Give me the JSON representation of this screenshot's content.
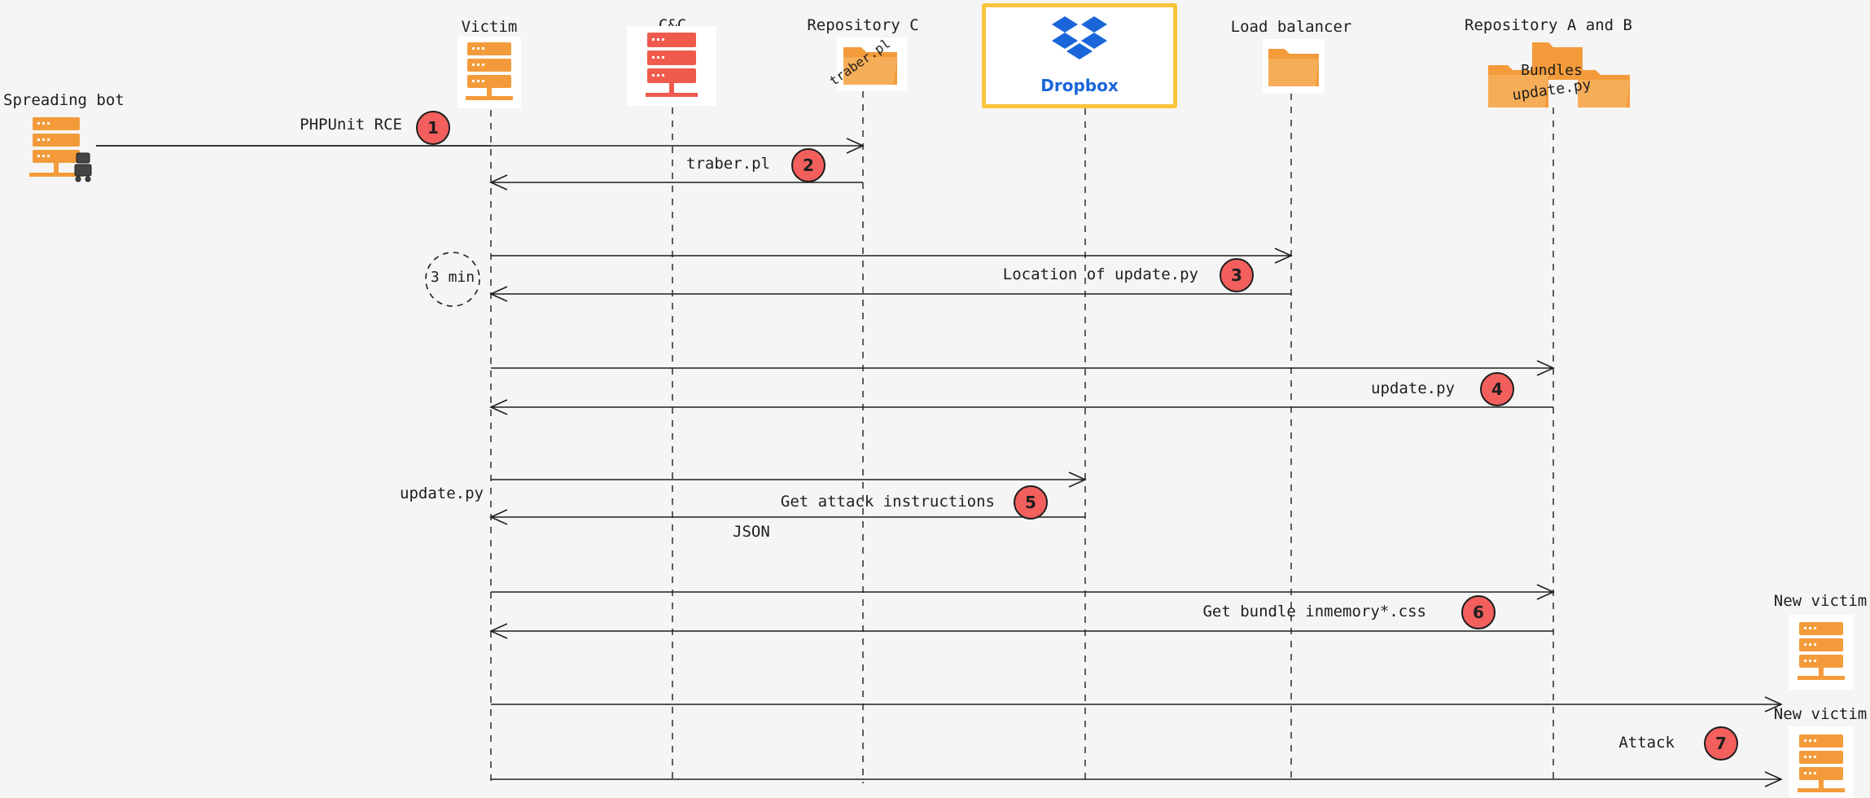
{
  "participants": {
    "spreading_bot": "Spreading bot",
    "victim": "Victim",
    "cnc": "C&C",
    "repo_c": "Repository C",
    "dropbox": "Dropbox",
    "load_balancer": "Load balancer",
    "repo_ab": "Repository A and B",
    "new_victim_1": "New victim",
    "new_victim_2": "New victim"
  },
  "folder_labels": {
    "repo_c_file": "traber.pl",
    "repo_ab_bundles": "Bundles",
    "repo_ab_file": "update.py"
  },
  "timer": "3 min",
  "messages": {
    "m1": "PHPUnit RCE",
    "m2": "traber.pl",
    "m3": "Location of update.py",
    "m4": "update.py",
    "m5_side": "update.py",
    "m5": "Get attack instructions",
    "m5_reply": "JSON",
    "m6": "Get bundle inmemory*.css",
    "m7": "Attack"
  },
  "steps": [
    "1",
    "2",
    "3",
    "4",
    "5",
    "6",
    "7"
  ],
  "colors": {
    "background": "#f5f5f5",
    "server_orange": "#f39b3a",
    "server_red": "#ef5a4c",
    "folder_orange": "#f39b3a",
    "badge_red": "#f25f5c",
    "dropbox_blue": "#1a66d9",
    "dropbox_frame": "#f8c43b",
    "line": "#1e1e1e"
  }
}
